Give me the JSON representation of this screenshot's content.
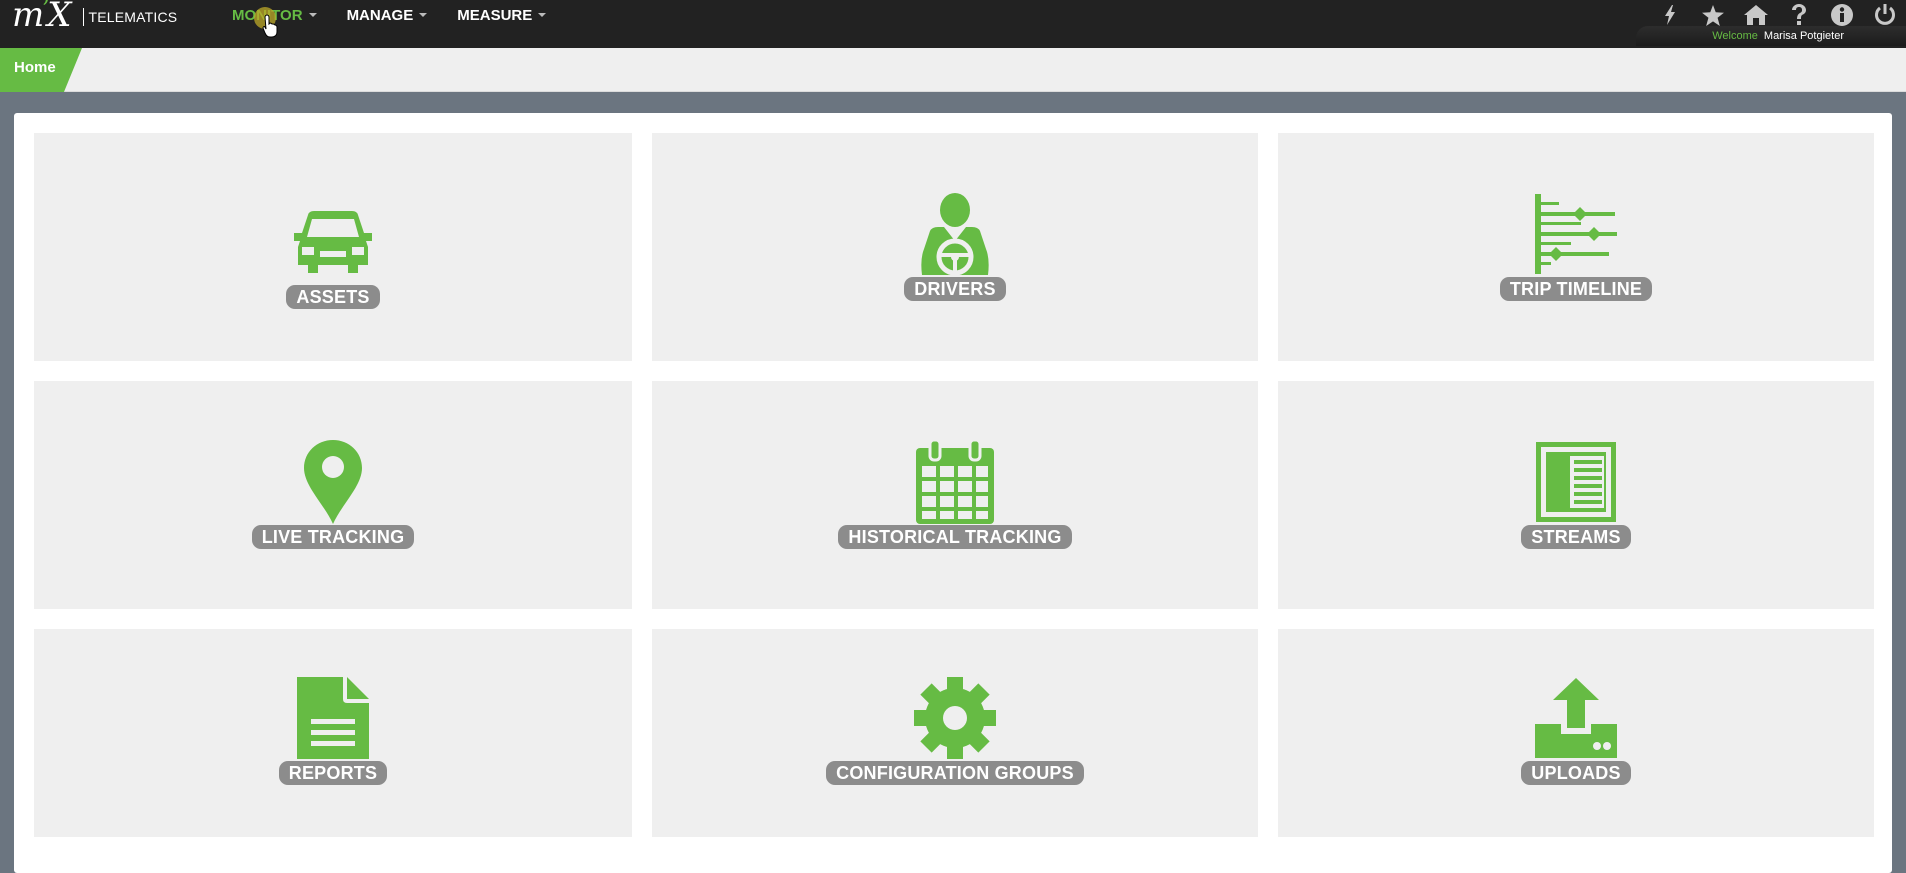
{
  "app": {
    "logo_text": "TELEMATICS"
  },
  "nav": {
    "items": [
      {
        "label": "MONITOR",
        "active": true
      },
      {
        "label": "MANAGE",
        "active": false
      },
      {
        "label": "MEASURE",
        "active": false
      }
    ]
  },
  "top_icons": [
    "lightning-icon",
    "star-icon",
    "home-icon",
    "help-icon",
    "info-icon",
    "power-icon"
  ],
  "user": {
    "welcome_label": "Welcome",
    "name": "Marisa Potgieter"
  },
  "breadcrumb": {
    "home": "Home"
  },
  "tiles": [
    {
      "label": "ASSETS",
      "icon": "car-icon"
    },
    {
      "label": "DRIVERS",
      "icon": "driver-icon"
    },
    {
      "label": "TRIP TIMELINE",
      "icon": "timeline-icon"
    },
    {
      "label": "LIVE TRACKING",
      "icon": "map-pin-icon"
    },
    {
      "label": "HISTORICAL TRACKING",
      "icon": "calendar-icon"
    },
    {
      "label": "STREAMS",
      "icon": "streams-icon"
    },
    {
      "label": "REPORTS",
      "icon": "document-icon"
    },
    {
      "label": "CONFIGURATION GROUPS",
      "icon": "gear-icon"
    },
    {
      "label": "UPLOADS",
      "icon": "upload-icon"
    }
  ],
  "colors": {
    "accent": "#66bb44",
    "topbar": "#222222",
    "tile_bg": "#efefef",
    "label_bg": "#8c8c8c",
    "page_bg": "#6b7580"
  }
}
